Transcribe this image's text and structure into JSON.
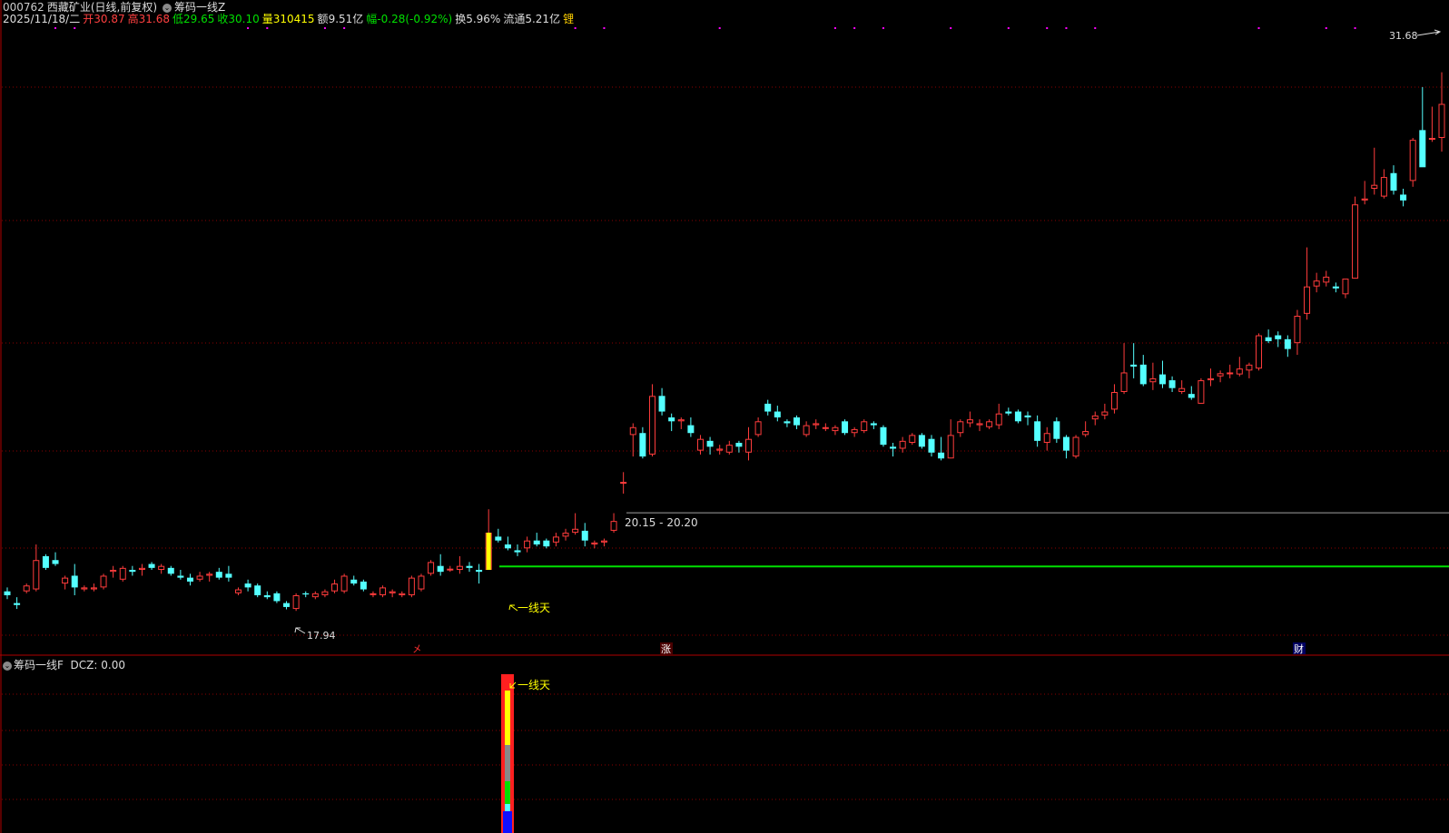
{
  "header": {
    "code": "000762",
    "name": "西藏矿业",
    "mode": "(日线,前复权)",
    "indicator": "筹码一线Z",
    "date": "2025/11/18/二",
    "open_label": "开",
    "open": "30.87",
    "high_label": "高",
    "high": "31.68",
    "low_label": "低",
    "low": "29.65",
    "close_label": "收",
    "close": "30.10",
    "vol_label": "量",
    "vol": "310415",
    "amt_label": "额",
    "amt": "9.51亿",
    "chg_label": "幅",
    "chg": "-0.28(-0.92%)",
    "turn_label": "换",
    "turn": "5.96%",
    "float_label": "流通",
    "float": "5.21亿",
    "lock_label": "锂"
  },
  "annotations": {
    "high_marker": "31.68",
    "low_marker": "17.94",
    "price_range": "20.15 - 20.20",
    "signal_label": "一线天",
    "sub_signal_label": "一线天",
    "event_1": "㐅",
    "event_2": "涨",
    "event_3": "财"
  },
  "sub_panel": {
    "title": "筹码一线F",
    "dcz": "DCZ: 0.00"
  },
  "colors": {
    "up": "#ff3c3c",
    "down": "#54ffff",
    "yellow": "#ffff00",
    "green_line": "#00e000",
    "grid": "#8b0000",
    "magenta": "#ff00ff"
  },
  "chart_data": {
    "type": "candlestick",
    "ylim": [
      17.0,
      32.6
    ],
    "candles": [
      [
        18.4,
        18.5,
        18.2,
        18.3
      ],
      [
        18.1,
        18.25,
        17.95,
        18.05
      ],
      [
        18.4,
        18.6,
        18.35,
        18.55
      ],
      [
        18.45,
        19.6,
        18.4,
        19.2
      ],
      [
        19.3,
        19.35,
        18.95,
        19.0
      ],
      [
        19.2,
        19.4,
        19.05,
        19.1
      ],
      [
        18.6,
        18.8,
        18.45,
        18.75
      ],
      [
        18.8,
        19.1,
        18.3,
        18.5
      ],
      [
        18.45,
        18.55,
        18.4,
        18.5
      ],
      [
        18.45,
        18.6,
        18.4,
        18.5
      ],
      [
        18.5,
        18.85,
        18.45,
        18.8
      ],
      [
        18.9,
        19.05,
        18.75,
        18.95
      ],
      [
        18.7,
        19.05,
        18.65,
        19.0
      ],
      [
        18.95,
        19.05,
        18.8,
        18.9
      ],
      [
        18.95,
        19.1,
        18.8,
        19.0
      ],
      [
        19.1,
        19.15,
        18.95,
        19.0
      ],
      [
        18.95,
        19.1,
        18.85,
        19.05
      ],
      [
        19.0,
        19.05,
        18.8,
        18.85
      ],
      [
        18.8,
        18.95,
        18.7,
        18.75
      ],
      [
        18.75,
        18.85,
        18.55,
        18.65
      ],
      [
        18.7,
        18.9,
        18.65,
        18.8
      ],
      [
        18.8,
        18.9,
        18.65,
        18.85
      ],
      [
        18.9,
        19.0,
        18.7,
        18.75
      ],
      [
        18.85,
        19.05,
        18.65,
        18.75
      ],
      [
        18.35,
        18.5,
        18.3,
        18.45
      ],
      [
        18.6,
        18.7,
        18.4,
        18.5
      ],
      [
        18.55,
        18.6,
        18.25,
        18.3
      ],
      [
        18.3,
        18.4,
        18.2,
        18.25
      ],
      [
        18.35,
        18.4,
        18.1,
        18.15
      ],
      [
        18.1,
        18.15,
        17.94,
        18.0
      ],
      [
        17.95,
        18.35,
        17.9,
        18.3
      ],
      [
        18.35,
        18.4,
        18.25,
        18.32
      ],
      [
        18.25,
        18.4,
        18.2,
        18.35
      ],
      [
        18.3,
        18.45,
        18.25,
        18.4
      ],
      [
        18.4,
        18.7,
        18.35,
        18.6
      ],
      [
        18.4,
        18.85,
        18.35,
        18.8
      ],
      [
        18.7,
        18.8,
        18.55,
        18.6
      ],
      [
        18.65,
        18.7,
        18.4,
        18.45
      ],
      [
        18.35,
        18.4,
        18.25,
        18.35
      ],
      [
        18.3,
        18.55,
        18.25,
        18.5
      ],
      [
        18.35,
        18.45,
        18.25,
        18.4
      ],
      [
        18.3,
        18.4,
        18.25,
        18.35
      ],
      [
        18.3,
        18.8,
        18.25,
        18.75
      ],
      [
        18.45,
        18.85,
        18.4,
        18.8
      ],
      [
        18.85,
        19.2,
        18.8,
        19.15
      ],
      [
        19.05,
        19.35,
        18.8,
        18.9
      ],
      [
        18.95,
        19.05,
        18.9,
        18.98
      ],
      [
        18.95,
        19.3,
        18.85,
        19.05
      ],
      [
        19.05,
        19.15,
        18.9,
        19.0
      ],
      [
        18.95,
        19.1,
        18.6,
        18.9
      ],
      [
        18.95,
        20.5,
        18.95,
        19.9
      ],
      [
        19.8,
        20.0,
        19.65,
        19.7
      ],
      [
        19.6,
        19.8,
        19.45,
        19.5
      ],
      [
        19.45,
        19.6,
        19.3,
        19.4
      ],
      [
        19.5,
        19.8,
        19.4,
        19.7
      ],
      [
        19.7,
        19.9,
        19.55,
        19.6
      ],
      [
        19.7,
        19.75,
        19.5,
        19.55
      ],
      [
        19.65,
        19.9,
        19.55,
        19.8
      ],
      [
        19.8,
        20.0,
        19.7,
        19.9
      ],
      [
        19.9,
        20.4,
        19.85,
        20.0
      ],
      [
        19.95,
        20.15,
        19.55,
        19.7
      ],
      [
        19.6,
        19.7,
        19.5,
        19.65
      ],
      [
        19.65,
        19.75,
        19.55,
        19.7
      ],
      [
        19.95,
        20.4,
        19.9,
        20.2
      ],
      [
        21.2,
        21.45,
        20.9,
        21.2
      ],
      [
        22.4,
        22.7,
        21.85,
        22.6
      ],
      [
        22.45,
        22.6,
        21.8,
        21.85
      ],
      [
        21.9,
        23.7,
        21.85,
        23.4
      ],
      [
        23.4,
        23.6,
        22.9,
        23.0
      ],
      [
        22.85,
        22.95,
        22.5,
        22.75
      ],
      [
        22.75,
        22.85,
        22.55,
        22.8
      ],
      [
        22.65,
        22.85,
        22.35,
        22.45
      ],
      [
        22.0,
        22.4,
        21.9,
        22.3
      ],
      [
        22.25,
        22.35,
        21.9,
        22.1
      ],
      [
        22.0,
        22.15,
        21.9,
        22.05
      ],
      [
        21.95,
        22.25,
        21.9,
        22.15
      ],
      [
        22.2,
        22.25,
        21.95,
        22.1
      ],
      [
        21.95,
        22.6,
        21.75,
        22.3
      ],
      [
        22.4,
        22.85,
        22.35,
        22.75
      ],
      [
        23.2,
        23.3,
        22.9,
        23.0
      ],
      [
        23.0,
        23.15,
        22.75,
        22.85
      ],
      [
        22.75,
        22.8,
        22.6,
        22.7
      ],
      [
        22.85,
        22.9,
        22.55,
        22.65
      ],
      [
        22.4,
        22.75,
        22.35,
        22.65
      ],
      [
        22.65,
        22.8,
        22.55,
        22.7
      ],
      [
        22.6,
        22.7,
        22.5,
        22.6
      ],
      [
        22.5,
        22.65,
        22.4,
        22.6
      ],
      [
        22.75,
        22.8,
        22.4,
        22.45
      ],
      [
        22.45,
        22.6,
        22.35,
        22.55
      ],
      [
        22.5,
        22.8,
        22.45,
        22.75
      ],
      [
        22.7,
        22.75,
        22.55,
        22.65
      ],
      [
        22.6,
        22.65,
        22.1,
        22.15
      ],
      [
        22.1,
        22.2,
        21.85,
        22.05
      ],
      [
        22.05,
        22.35,
        21.95,
        22.25
      ],
      [
        22.2,
        22.45,
        22.15,
        22.4
      ],
      [
        22.4,
        22.45,
        22.05,
        22.1
      ],
      [
        22.3,
        22.4,
        21.85,
        21.95
      ],
      [
        21.95,
        22.35,
        21.75,
        21.8
      ],
      [
        21.8,
        22.8,
        21.8,
        22.4
      ],
      [
        22.45,
        22.8,
        22.35,
        22.75
      ],
      [
        22.7,
        23.0,
        22.6,
        22.8
      ],
      [
        22.65,
        22.8,
        22.5,
        22.7
      ],
      [
        22.6,
        22.8,
        22.55,
        22.75
      ],
      [
        22.65,
        23.2,
        22.55,
        22.95
      ],
      [
        23.0,
        23.1,
        22.9,
        22.95
      ],
      [
        23.0,
        23.05,
        22.7,
        22.75
      ],
      [
        22.9,
        23.0,
        22.65,
        22.85
      ],
      [
        22.75,
        22.9,
        22.1,
        22.25
      ],
      [
        22.2,
        22.6,
        22.0,
        22.45
      ],
      [
        22.75,
        22.85,
        22.2,
        22.3
      ],
      [
        22.35,
        22.4,
        21.8,
        22.0
      ],
      [
        21.85,
        22.4,
        21.8,
        22.35
      ],
      [
        22.4,
        22.75,
        22.35,
        22.5
      ],
      [
        22.8,
        23.0,
        22.65,
        22.9
      ],
      [
        22.9,
        23.2,
        22.8,
        23.0
      ],
      [
        23.05,
        23.7,
        22.95,
        23.5
      ],
      [
        23.5,
        24.75,
        23.45,
        24.0
      ],
      [
        24.2,
        24.75,
        23.85,
        24.15
      ],
      [
        24.2,
        24.45,
        23.65,
        23.7
      ],
      [
        23.75,
        24.25,
        23.55,
        23.85
      ],
      [
        23.95,
        24.3,
        23.6,
        23.7
      ],
      [
        23.8,
        23.9,
        23.5,
        23.6
      ],
      [
        23.5,
        23.8,
        23.45,
        23.6
      ],
      [
        23.45,
        23.65,
        23.3,
        23.35
      ],
      [
        23.2,
        23.85,
        23.2,
        23.8
      ],
      [
        23.8,
        24.1,
        23.65,
        23.85
      ],
      [
        23.9,
        24.05,
        23.75,
        23.98
      ],
      [
        24.0,
        24.2,
        23.85,
        24.0
      ],
      [
        23.95,
        24.4,
        23.9,
        24.1
      ],
      [
        24.05,
        24.25,
        23.85,
        24.2
      ],
      [
        24.1,
        25.0,
        24.05,
        24.95
      ],
      [
        24.9,
        25.1,
        24.75,
        24.8
      ],
      [
        24.95,
        25.05,
        24.65,
        24.85
      ],
      [
        24.85,
        24.95,
        24.4,
        24.6
      ],
      [
        24.75,
        25.6,
        24.45,
        25.45
      ],
      [
        25.5,
        27.2,
        25.35,
        26.2
      ],
      [
        26.2,
        26.55,
        26.05,
        26.35
      ],
      [
        26.3,
        26.6,
        26.2,
        26.45
      ],
      [
        26.2,
        26.3,
        26.05,
        26.15
      ],
      [
        26.0,
        26.35,
        25.9,
        26.4
      ],
      [
        26.4,
        28.5,
        26.4,
        28.3
      ],
      [
        28.4,
        28.9,
        28.3,
        28.45
      ],
      [
        28.7,
        29.75,
        28.55,
        28.8
      ],
      [
        28.5,
        29.2,
        28.45,
        29.0
      ],
      [
        29.1,
        29.3,
        28.55,
        28.65
      ],
      [
        28.55,
        28.7,
        28.25,
        28.4
      ],
      [
        28.9,
        30.0,
        28.75,
        29.95
      ],
      [
        30.2,
        31.3,
        29.9,
        29.25
      ],
      [
        30.0,
        30.8,
        29.9,
        30.0
      ],
      [
        30.0,
        31.68,
        29.65,
        30.87
      ]
    ],
    "support_price": 20.15,
    "resistance_price": 20.2,
    "marker_positions": [
      5,
      7,
      25,
      27,
      33,
      35,
      59,
      62,
      74,
      86,
      88,
      91,
      98,
      104,
      108,
      110,
      113,
      130,
      137,
      140
    ]
  }
}
